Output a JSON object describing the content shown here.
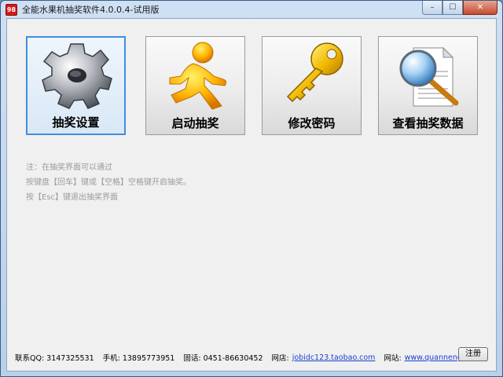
{
  "window": {
    "title": "全能水果机抽奖软件4.0.0.4-试用版",
    "app_icon_text": "98",
    "minimize_glyph": "–",
    "maximize_glyph": "☐",
    "close_glyph": "✕"
  },
  "tiles": [
    {
      "label": "抽奖设置",
      "icon": "gear-icon",
      "selected": true
    },
    {
      "label": "启动抽奖",
      "icon": "running-man-icon",
      "selected": false
    },
    {
      "label": "修改密码",
      "icon": "key-icon",
      "selected": false
    },
    {
      "label": "查看抽奖数据",
      "icon": "document-search-icon",
      "selected": false
    }
  ],
  "notes": [
    "注：在抽奖界面可以通过",
    "按键盘【回车】键或【空格】空格键开启抽奖。",
    "按【Esc】键退出抽奖界面"
  ],
  "footer": {
    "qq": "联系QQ: 3147325531",
    "phone": "手机: 13895773951",
    "tel": "固话: 0451-86630452",
    "shop_label": "网店:",
    "shop_link": "jobidc123.taobao.com",
    "site_label": "网站:",
    "site_link": "www.quannengsoft.cn",
    "register_label": "注册"
  },
  "colors": {
    "selected_border": "#3f8ede",
    "link": "#1a3fd0",
    "note_text": "#9a9a9a"
  }
}
